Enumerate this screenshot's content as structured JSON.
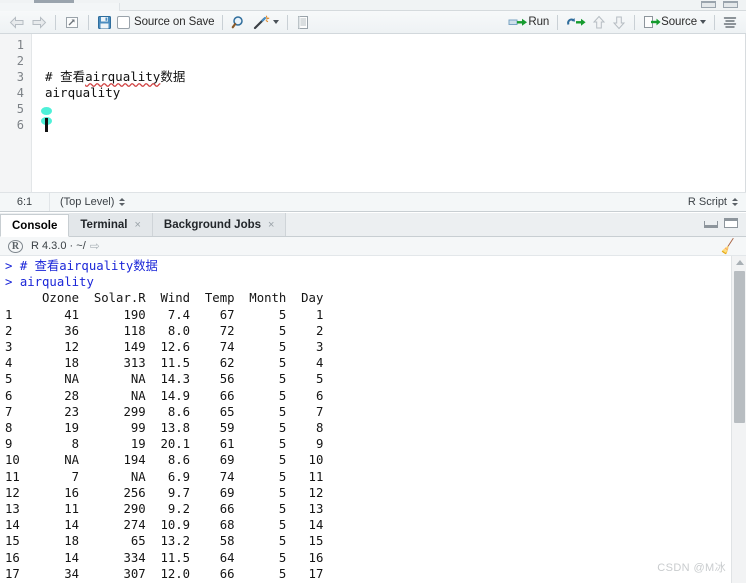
{
  "window": {
    "min_label": "minimize",
    "max_label": "maximize"
  },
  "source_toolbar": {
    "back_icon": "back-arrow-icon",
    "forward_icon": "forward-arrow-icon",
    "popout_icon": "show-in-new-window-icon",
    "save_icon": "save-icon",
    "source_on_save_label": "Source on Save",
    "find_icon": "find-replace-icon",
    "code_tools_icon": "code-tools-magic-wand-icon",
    "compile_report_icon": "compile-report-icon",
    "run_label": "Run",
    "run_icon": "run-icon",
    "rerun_icon": "re-run-previous-icon",
    "up_icon": "go-to-previous-chunk-icon",
    "down_icon": "go-to-next-chunk-icon",
    "source_label": "Source",
    "source_icon": "source-icon",
    "outline_icon": "document-outline-icon"
  },
  "editor": {
    "lines": [
      {
        "num": "1",
        "text": ""
      },
      {
        "num": "2",
        "text": ""
      },
      {
        "num": "3",
        "comment_prefix": "# ",
        "comment_cn1": "查看",
        "comment_word": "airquality",
        "comment_cn2": "数据"
      },
      {
        "num": "4",
        "text": "airquality"
      },
      {
        "num": "5",
        "text": ""
      },
      {
        "num": "6",
        "text": ""
      }
    ]
  },
  "editor_status": {
    "cursor_position": "6:1",
    "scope": "(Top Level)",
    "file_type": "R Script"
  },
  "console_tabs": [
    {
      "label": "Console",
      "active": true,
      "closable": false
    },
    {
      "label": "Terminal",
      "active": false,
      "closable": true,
      "close": "×"
    },
    {
      "label": "Background Jobs",
      "active": false,
      "closable": true,
      "close": "×"
    }
  ],
  "console_header": {
    "r_glyph": "R",
    "version": "R 4.3.0",
    "separator": "·",
    "working_dir": "~/",
    "expand_arrow": "⇨",
    "broom_icon": "clear-console-broom-icon"
  },
  "console": {
    "prompt": ">",
    "commands": [
      "# 查看airquality数据",
      "airquality"
    ],
    "table": {
      "columns": [
        "",
        "Ozone",
        "Solar.R",
        "Wind",
        "Temp",
        "Month",
        "Day"
      ],
      "rows": [
        [
          "1",
          "41",
          "190",
          "7.4",
          "67",
          "5",
          "1"
        ],
        [
          "2",
          "36",
          "118",
          "8.0",
          "72",
          "5",
          "2"
        ],
        [
          "3",
          "12",
          "149",
          "12.6",
          "74",
          "5",
          "3"
        ],
        [
          "4",
          "18",
          "313",
          "11.5",
          "62",
          "5",
          "4"
        ],
        [
          "5",
          "NA",
          "NA",
          "14.3",
          "56",
          "5",
          "5"
        ],
        [
          "6",
          "28",
          "NA",
          "14.9",
          "66",
          "5",
          "6"
        ],
        [
          "7",
          "23",
          "299",
          "8.6",
          "65",
          "5",
          "7"
        ],
        [
          "8",
          "19",
          "99",
          "13.8",
          "59",
          "5",
          "8"
        ],
        [
          "9",
          "8",
          "19",
          "20.1",
          "61",
          "5",
          "9"
        ],
        [
          "10",
          "NA",
          "194",
          "8.6",
          "69",
          "5",
          "10"
        ],
        [
          "11",
          "7",
          "NA",
          "6.9",
          "74",
          "5",
          "11"
        ],
        [
          "12",
          "16",
          "256",
          "9.7",
          "69",
          "5",
          "12"
        ],
        [
          "13",
          "11",
          "290",
          "9.2",
          "66",
          "5",
          "13"
        ],
        [
          "14",
          "14",
          "274",
          "10.9",
          "68",
          "5",
          "14"
        ],
        [
          "15",
          "18",
          "65",
          "13.2",
          "58",
          "5",
          "15"
        ],
        [
          "16",
          "14",
          "334",
          "11.5",
          "64",
          "5",
          "16"
        ],
        [
          "17",
          "34",
          "307",
          "12.0",
          "66",
          "5",
          "17"
        ]
      ]
    }
  },
  "watermark": "CSDN @M冰"
}
